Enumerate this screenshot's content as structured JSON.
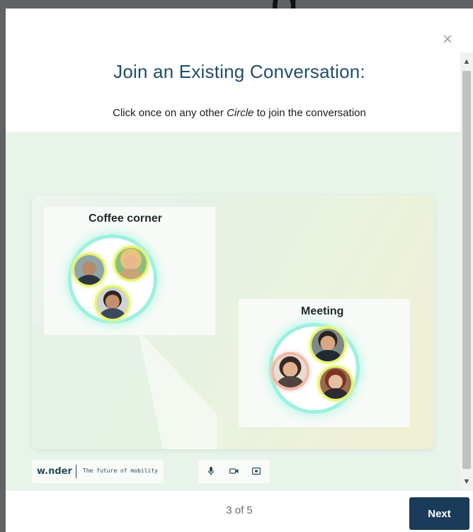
{
  "page": {
    "top_glyph": "g"
  },
  "modal": {
    "close_icon": "×",
    "title": "Join an Existing Conversation:",
    "subtitle_before": "Click once on any other ",
    "subtitle_emphasis": "Circle",
    "subtitle_after": " to join the conversation"
  },
  "preview": {
    "rooms": [
      {
        "title": "Coffee corner",
        "participants": 3
      },
      {
        "title": "Meeting",
        "participants": 3
      }
    ],
    "brand": "w.nder",
    "tagline": "The future of mobility",
    "toolbar_icons": [
      "microphone-icon",
      "camera-icon",
      "screen-share-icon"
    ]
  },
  "footer": {
    "progress": "3 of 5",
    "next_label": "Next"
  },
  "colors": {
    "title": "#1f4e6e",
    "next_button": "#1b3b5a",
    "circle_glow": "#9cf0e1",
    "avatar_ring": "#e7f26a",
    "avatar_ring_alt": "#f7b7a3"
  }
}
